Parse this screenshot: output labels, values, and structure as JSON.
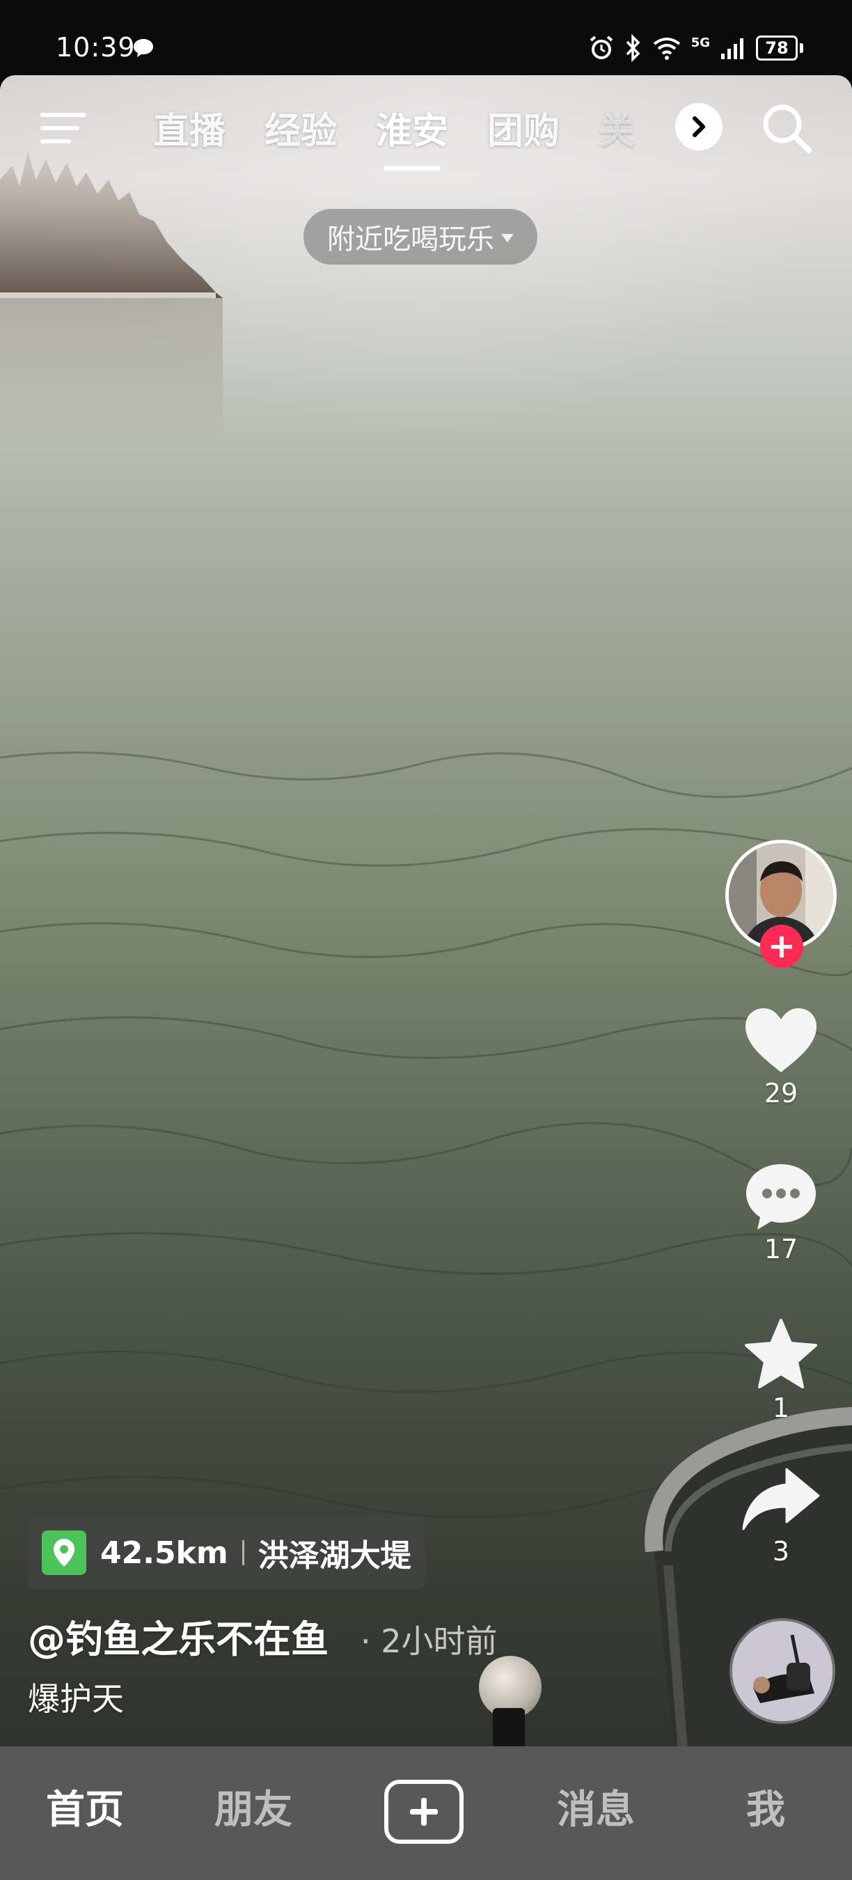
{
  "status_bar": {
    "time": "10:39",
    "battery": "78",
    "network": "5G"
  },
  "top_nav": {
    "tabs": [
      {
        "label": "直播"
      },
      {
        "label": "经验"
      },
      {
        "label": "淮安"
      },
      {
        "label": "团购"
      },
      {
        "label": "关"
      }
    ],
    "active_tab": "淮安",
    "nearby_filter": "附近吃喝玩乐"
  },
  "actions": {
    "likes": "29",
    "comments": "17",
    "favorites": "1",
    "shares": "3"
  },
  "post": {
    "location_distance": "42.5km",
    "location_name": "洪泽湖大堤",
    "author": "@钓鱼之乐不在鱼",
    "time_ago": "· 2小时前",
    "caption": "爆护天"
  },
  "bottom_nav": {
    "home": "首页",
    "friends": "朋友",
    "messages": "消息",
    "me": "我"
  },
  "colors": {
    "follow_accent": "#fe2c55",
    "location_pin": "#4cc35a",
    "nav_background": "#585858"
  }
}
